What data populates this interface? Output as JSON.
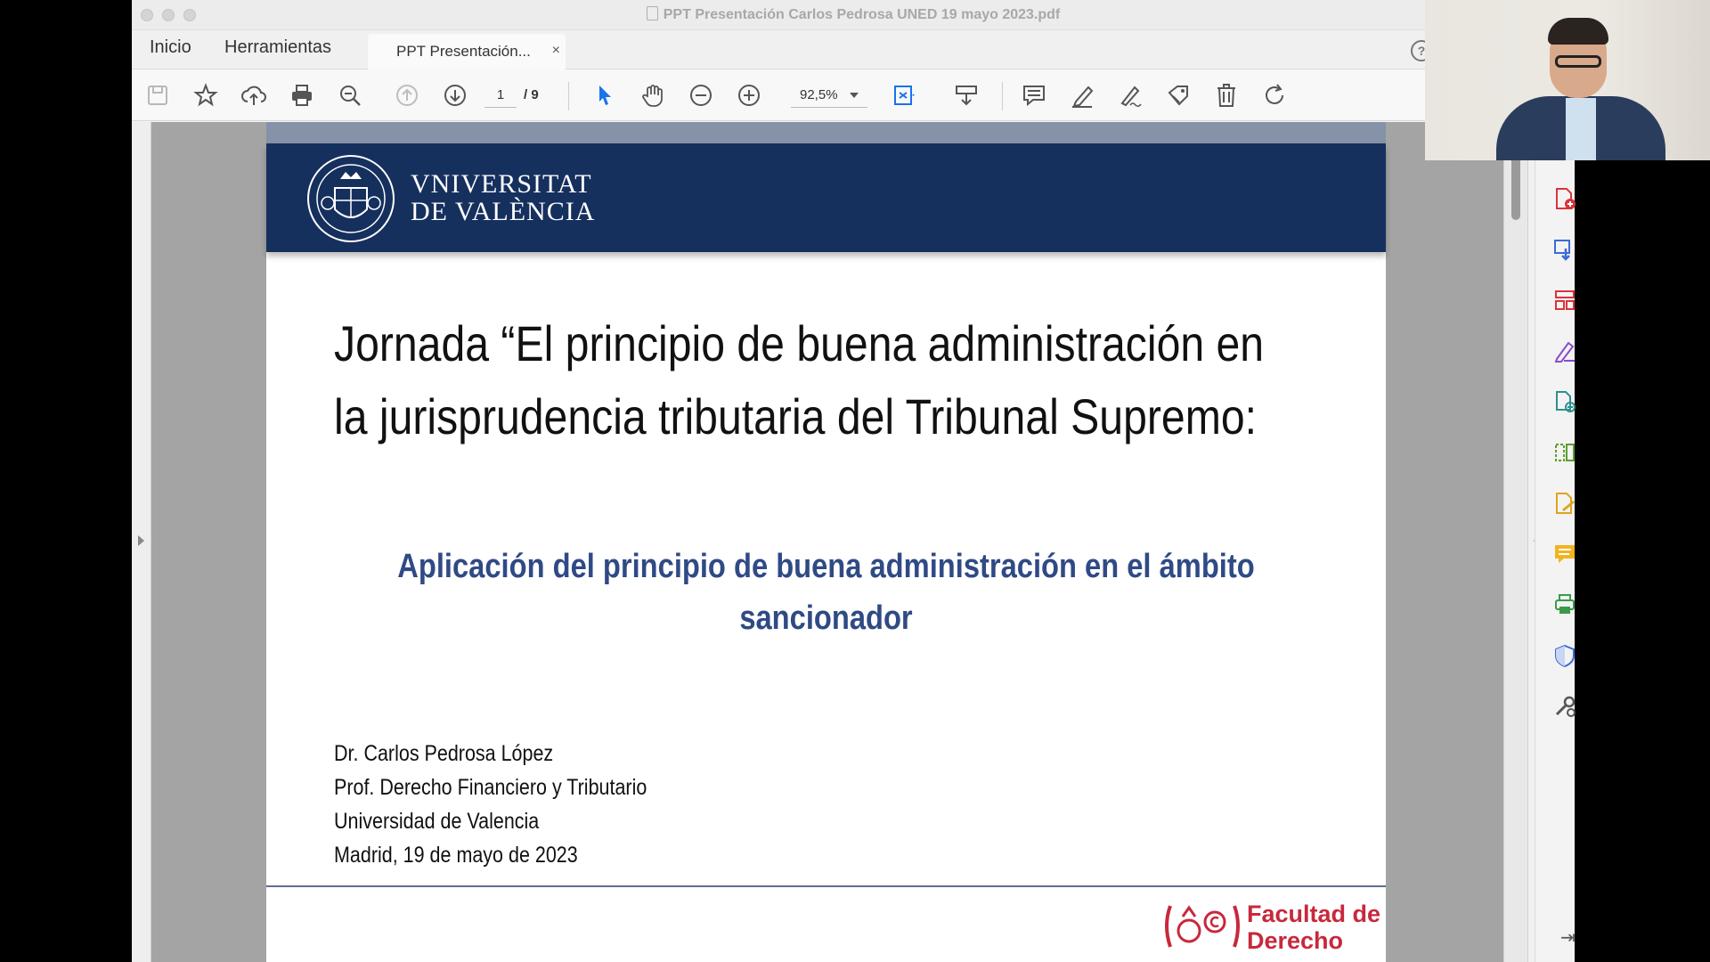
{
  "window": {
    "title": "PPT Presentación Carlos Pedrosa UNED 19 mayo 2023.pdf"
  },
  "menu": {
    "home": "Inicio",
    "tools": "Herramientas",
    "tab_label": "PPT Presentación...",
    "tab_close": "×",
    "help": "?"
  },
  "toolbar": {
    "page_current": "1",
    "page_total": "/ 9",
    "zoom": "92,5%"
  },
  "slide": {
    "university_line1": "VNIVERSITAT",
    "university_line2": "DE VALÈNCIA",
    "title_line1": "Jornada “El principio de buena administración en",
    "title_line2": "la jurisprudencia tributaria del Tribunal Supremo:",
    "subtitle_line1": "Aplicación del principio de buena administración en el ámbito",
    "subtitle_line2": "sancionador",
    "author_lines": [
      "Dr. Carlos Pedrosa López",
      "Prof. Derecho Financiero y Tributario",
      "Universidad de Valencia",
      "Madrid, 19 de mayo de 2023"
    ],
    "faculty_line1": "Facultad de",
    "faculty_line2": "Derecho"
  },
  "colors": {
    "banner": "#16305e",
    "subtitle": "#2f4a85",
    "faculty_red": "#c8283c",
    "selection_blue": "#1a73e8"
  },
  "icons": {
    "toolbar": [
      "save-icon",
      "star-icon",
      "upload-icon",
      "print-icon",
      "zoom-out-search-icon",
      "previous-page-icon",
      "next-page-icon",
      "select-cursor-icon",
      "hand-icon",
      "zoom-minus-icon",
      "zoom-plus-icon",
      "fit-page-icon",
      "scroll-mode-icon",
      "comment-icon",
      "highlight-pen-icon",
      "sign-icon",
      "stamp-icon",
      "delete-icon",
      "rotate-icon"
    ],
    "tools_panel": [
      "create-pdf-icon",
      "export-pdf-icon",
      "organize-pages-icon",
      "edit-pdf-icon",
      "combine-icon",
      "compress-icon",
      "fill-sign-icon",
      "comment-panel-icon",
      "print-production-icon",
      "protect-icon",
      "more-tools-icon"
    ]
  }
}
